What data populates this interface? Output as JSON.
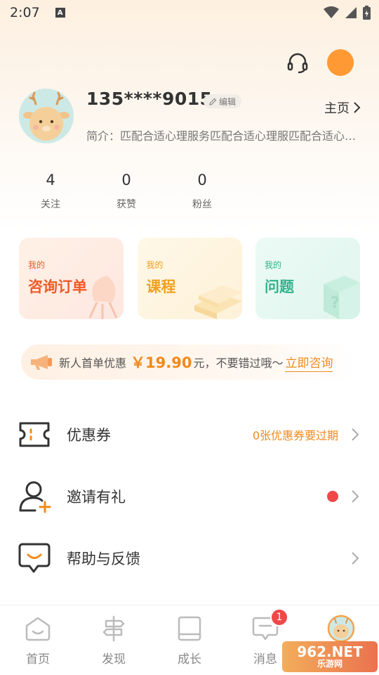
{
  "status_bar": {
    "time": "2:07",
    "notification_icon": "A"
  },
  "header": {
    "support_icon": "headset-icon",
    "settings_icon": "orange-circle"
  },
  "profile": {
    "phone": "135****9015",
    "edit_label": "编辑",
    "homepage_label": "主页",
    "bio": "简介：匹配合适心理服务匹配合适心理服匹配合适心理服务"
  },
  "stats": [
    {
      "value": "4",
      "label": "关注"
    },
    {
      "value": "0",
      "label": "获赞"
    },
    {
      "value": "0",
      "label": "粉丝"
    }
  ],
  "cards": [
    {
      "sub": "我的",
      "title": "咨询订单"
    },
    {
      "sub": "我的",
      "title": "课程"
    },
    {
      "sub": "我的",
      "title": "问题"
    }
  ],
  "promo": {
    "text_before": "新人首单优惠",
    "price": "￥19.90",
    "text_after": "元，不要错过哦～",
    "cta": "立即咨询"
  },
  "menu": [
    {
      "label": "优惠券",
      "extra": "0张优惠券要过期"
    },
    {
      "label": "邀请有礼",
      "extra": ""
    },
    {
      "label": "帮助与反馈",
      "extra": ""
    }
  ],
  "tabs": [
    {
      "label": "首页"
    },
    {
      "label": "发现"
    },
    {
      "label": "成长"
    },
    {
      "label": "消息",
      "badge": "1"
    },
    {
      "label": ""
    }
  ],
  "watermark": {
    "line1": "962.NET",
    "line2": "乐游网"
  },
  "colors": {
    "accent": "#f08a1c",
    "red": "#f04848",
    "orange": "#ff9933"
  }
}
